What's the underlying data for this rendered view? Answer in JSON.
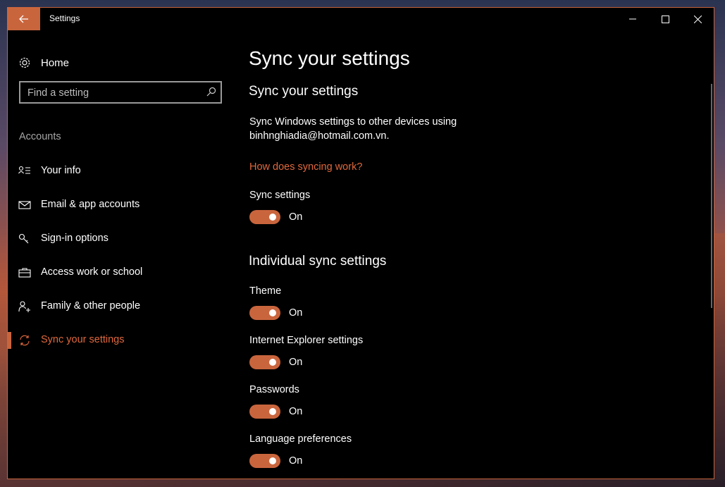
{
  "window": {
    "title": "Settings",
    "accent": "#c9653d"
  },
  "sidebar": {
    "home_label": "Home",
    "search_placeholder": "Find a setting",
    "section_label": "Accounts",
    "items": [
      {
        "label": "Your info",
        "icon": "person-card-icon"
      },
      {
        "label": "Email & app accounts",
        "icon": "mail-icon"
      },
      {
        "label": "Sign-in options",
        "icon": "key-icon"
      },
      {
        "label": "Access work or school",
        "icon": "briefcase-icon"
      },
      {
        "label": "Family & other people",
        "icon": "person-add-icon"
      },
      {
        "label": "Sync your settings",
        "icon": "sync-icon",
        "active": true
      }
    ]
  },
  "main": {
    "page_title": "Sync your settings",
    "section1_title": "Sync your settings",
    "description": "Sync Windows settings to other devices using binhnghiadia@hotmail.com.vn.",
    "link": "How does syncing work?",
    "sync_settings_label": "Sync settings",
    "sync_settings_state": "On",
    "section2_title": "Individual sync settings",
    "individual": [
      {
        "label": "Theme",
        "state": "On"
      },
      {
        "label": "Internet Explorer settings",
        "state": "On"
      },
      {
        "label": "Passwords",
        "state": "On"
      },
      {
        "label": "Language preferences",
        "state": "On"
      }
    ]
  }
}
